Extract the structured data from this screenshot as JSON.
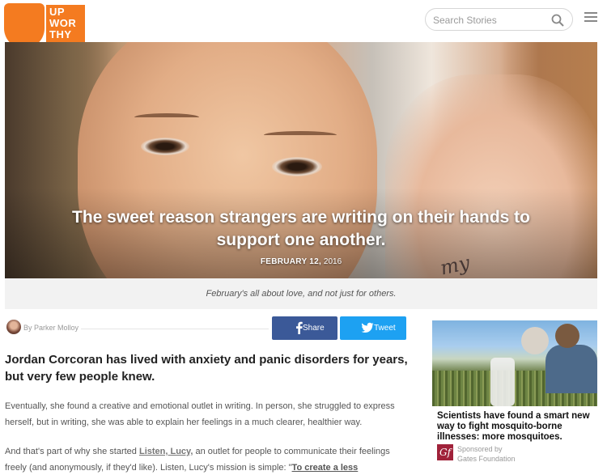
{
  "header": {
    "logo_lines": [
      "UP",
      "WOR",
      "THY"
    ],
    "search_placeholder": "Search Stories",
    "search_icon": "magnifier-icon",
    "menu_icon": "hamburger-icon",
    "brand_color": "#f47b20"
  },
  "hero": {
    "title": "The sweet reason strangers are writing on their hands to support one another.",
    "date_strong": "FEBRUARY 12,",
    "date_year": "2016",
    "hand_text": "my"
  },
  "caption": "February's all about love, and not just for others.",
  "byline": {
    "prefix": "By",
    "author": "Parker Molloy"
  },
  "share": {
    "facebook_label": "Share",
    "twitter_label": "Tweet",
    "facebook_color": "#3b5998",
    "twitter_color": "#1da1f2"
  },
  "article": {
    "lede": "Jordan Corcoran has lived with anxiety and panic disorders for years, but very few people knew.",
    "p1": "Eventually, she found a creative and emotional outlet in writing. In person, she struggled to express herself, but in writing, she was able to explain her feelings in a much clearer, healthier way.",
    "p2_before": "And that's part of why she started ",
    "p2_link": "Listen, Lucy,",
    "p2_after": " an outlet for people to communicate their feelings freely (and anonymously, if they'd like). Listen, Lucy's mission is simple: \"",
    "p2_quote": "To create a less"
  },
  "sponsored": {
    "title": "Scientists have found a smart new way to fight mosquito-borne illnesses: more mosquitoes.",
    "label": "Sponsored by",
    "sponsor": "Gates Foundation",
    "logo_text": "Gf",
    "logo_color": "#a0223a"
  }
}
